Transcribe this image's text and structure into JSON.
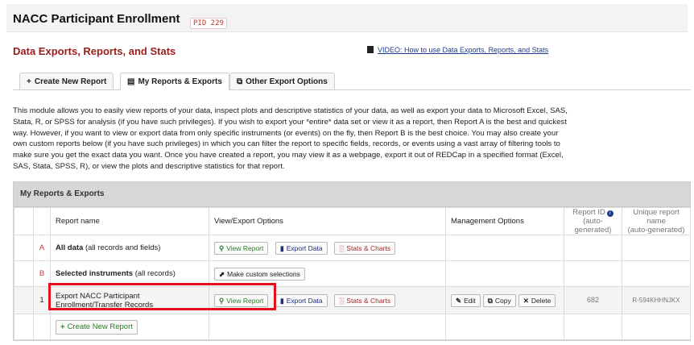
{
  "project": {
    "title": "NACC Participant Enrollment",
    "pid": "PID 229"
  },
  "page": {
    "title": "Data Exports, Reports, and Stats",
    "video_link": "VIDEO: How to use Data Exports, Reports, and Stats"
  },
  "tabs": [
    {
      "label": "Create New Report",
      "icon": "+"
    },
    {
      "label": "My Reports & Exports",
      "icon": "report-icon"
    },
    {
      "label": "Other Export Options",
      "icon": "export-icon"
    }
  ],
  "description": "This module allows you to easily view reports of your data, inspect plots and descriptive statistics of your data, as well as export your data to Microsoft Excel, SAS, Stata, R, or SPSS for analysis (if you have such privileges). If you wish to export your *entire* data set or view it as a report, then Report A is the best and quickest way. However, if you want to view or export data from only specific instruments (or events) on the fly, then Report B is the best choice. You may also create your own custom reports below (if you have such privileges) in which you can filter the report to specific fields, records, or events using a vast array of filtering tools to make sure you get the exact data you want. Once you have created a report, you may view it as a webpage, export it out of REDCap in a specified format (Excel, SAS, Stata, SPSS, R), or view the plots and descriptive statistics for that report.",
  "grid": {
    "title": "My Reports & Exports",
    "headers": {
      "name": "Report name",
      "view": "View/Export Options",
      "manage": "Management Options",
      "report_id": "Report ID",
      "report_id_sub": "(auto-generated)",
      "unique_name": "Unique report name",
      "unique_name_sub": "(auto-generated)"
    },
    "rows": [
      {
        "label": "A",
        "name_bold": "All data",
        "name_rest": " (all records and fields)"
      },
      {
        "label": "B",
        "name_bold": "Selected instruments",
        "name_rest": " (all records)"
      },
      {
        "label": "1",
        "name": "Export NACC Participant Enrollment/Transfer Records",
        "report_id": "682",
        "unique_name": "R-594KHHNJKX"
      }
    ],
    "buttons": {
      "view_report": "View Report",
      "export_data": "Export Data",
      "stats_charts": "Stats & Charts",
      "custom_selections": "Make custom selections",
      "edit": "Edit",
      "copy": "Copy",
      "delete": "Delete",
      "create_new": "Create New Report"
    }
  },
  "colors": {
    "title_red": "#9b1c1c",
    "highlight_box": "#e3101e",
    "green_button": "#2a7d2a"
  }
}
